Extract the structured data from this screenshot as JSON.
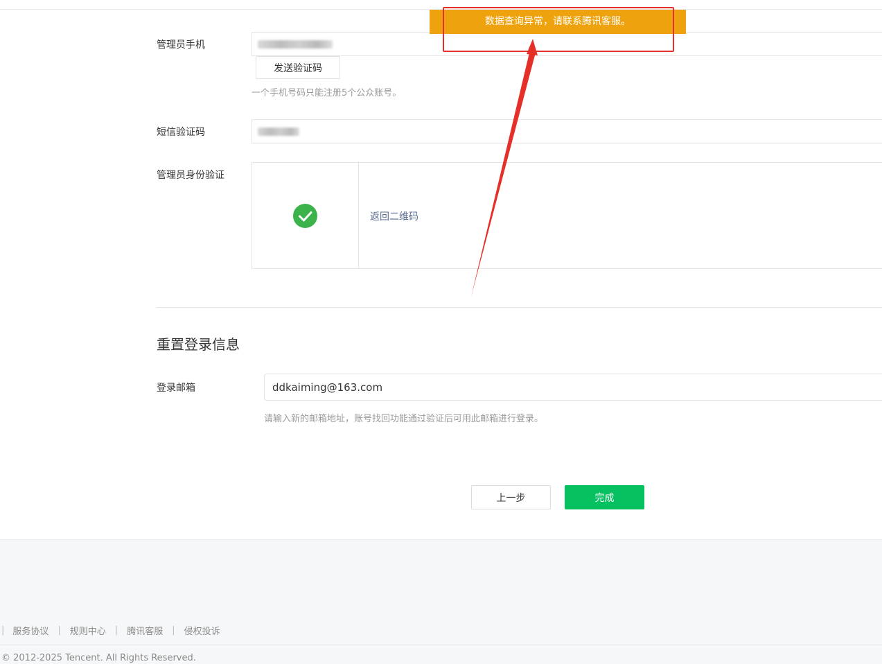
{
  "form": {
    "phone_label": "管理员手机",
    "send_code_label": "发送验证码",
    "phone_tip": "一个手机号码只能注册5个公众账号。",
    "sms_label": "短信验证码",
    "identity_label": "管理员身份验证",
    "back_qr_label": "返回二维码"
  },
  "reset": {
    "title": "重置登录信息",
    "email_label": "登录邮箱",
    "email_value": "ddkaiming@163.com",
    "email_tip": "请输入新的邮箱地址，账号找回功能通过验证后可用此邮箱进行登录。"
  },
  "actions": {
    "prev_label": "上一步",
    "done_label": "完成"
  },
  "toast": {
    "message": "数据查询异常，请联系腾讯客服。"
  },
  "footer": {
    "links": [
      "服务协议",
      "规则中心",
      "腾讯客服",
      "侵权投诉"
    ],
    "copyright": "© 2012-2025 Tencent. All Rights Reserved."
  },
  "colors": {
    "primary": "#07c160",
    "toast": "#eea20d",
    "annotation": "#e5302a",
    "link": "#576b95"
  }
}
